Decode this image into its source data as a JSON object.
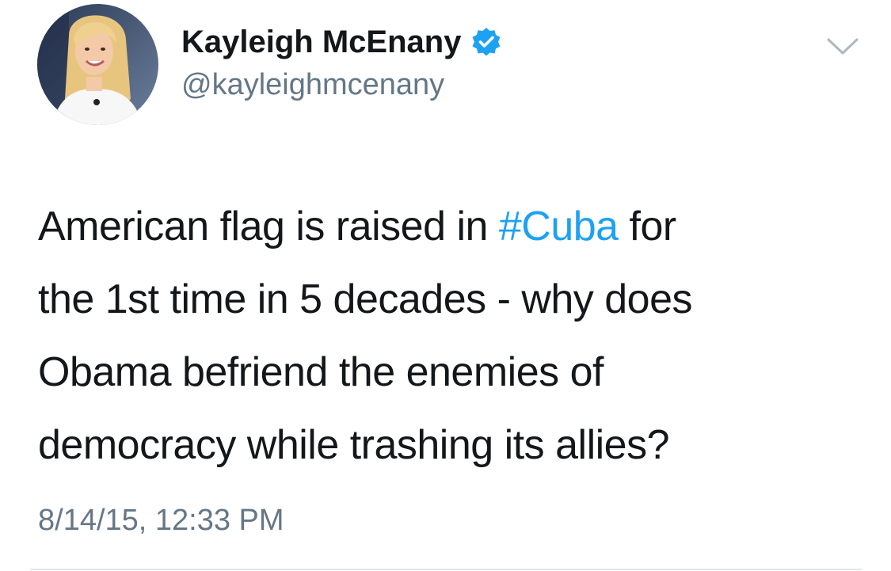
{
  "author": {
    "name": "Kayleigh McEnany",
    "handle": "@kayleighmcenany",
    "verified": true,
    "avatar_icon": "profile-photo"
  },
  "tweet": {
    "lines": [
      {
        "before": "American flag is raised in ",
        "hashtag": "#Cuba",
        "after": " for"
      },
      {
        "text": "the 1st time in 5 decades - why does"
      },
      {
        "text": "Obama befriend the enemies of"
      },
      {
        "text": "democracy while trashing its allies?"
      }
    ],
    "timestamp": "8/14/15, 12:33 PM"
  },
  "menu": {
    "icon": "chevron-down-icon"
  },
  "colors": {
    "text": "#14171a",
    "secondary": "#657786",
    "link": "#1da1f2",
    "verified": "#1da1f2",
    "divider": "#e1e8ed"
  }
}
